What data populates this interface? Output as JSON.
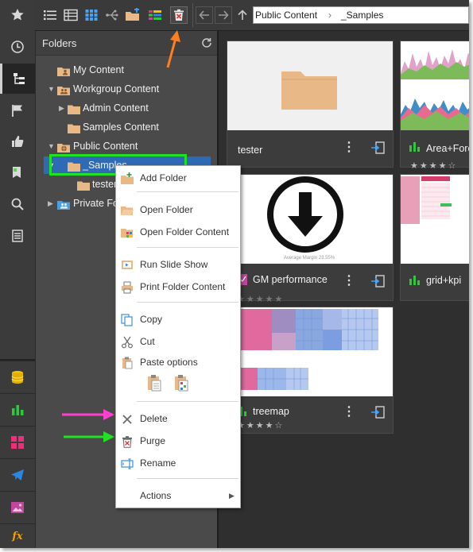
{
  "toolbar": {
    "breadcrumb": [
      "Public Content",
      "_Samples"
    ]
  },
  "folders_panel": {
    "title": "Folders",
    "tree": [
      {
        "label": "My Content"
      },
      {
        "label": "Workgroup Content"
      },
      {
        "label": "Admin Content"
      },
      {
        "label": "Samples Content"
      },
      {
        "label": "Public Content"
      },
      {
        "label": "_Samples"
      },
      {
        "label": "tester"
      },
      {
        "label": "Private Folders"
      }
    ]
  },
  "context_menu": {
    "items": [
      {
        "label": "Add Folder"
      },
      {
        "label": "Open Folder"
      },
      {
        "label": "Open Folder Content"
      },
      {
        "label": "Run Slide Show"
      },
      {
        "label": "Print Folder Content"
      },
      {
        "label": "Copy"
      },
      {
        "label": "Cut"
      },
      {
        "label": "Paste options"
      },
      {
        "label": "Delete"
      },
      {
        "label": "Purge"
      },
      {
        "label": "Rename"
      },
      {
        "label": "Actions"
      }
    ]
  },
  "cards": [
    {
      "name": "tester",
      "kind": "folder"
    },
    {
      "name": "Area+Forecast",
      "kind": "chart",
      "rating": 4
    },
    {
      "name": "GM performance",
      "kind": "chart",
      "rating": 0,
      "thumb_caption": "Average Margin 23.55%"
    },
    {
      "name": "grid+kpi",
      "kind": "chart",
      "rating": 0
    },
    {
      "name": "treemap",
      "kind": "chart",
      "rating": 4
    }
  ],
  "colors": {
    "accent_green": "#2ecc40",
    "folder": "#e8b887",
    "highlight_blue": "#2f6bb5",
    "arrow_orange": "#ff7f1f",
    "arrow_magenta": "#ff3fd0",
    "arrow_green": "#22e022"
  }
}
